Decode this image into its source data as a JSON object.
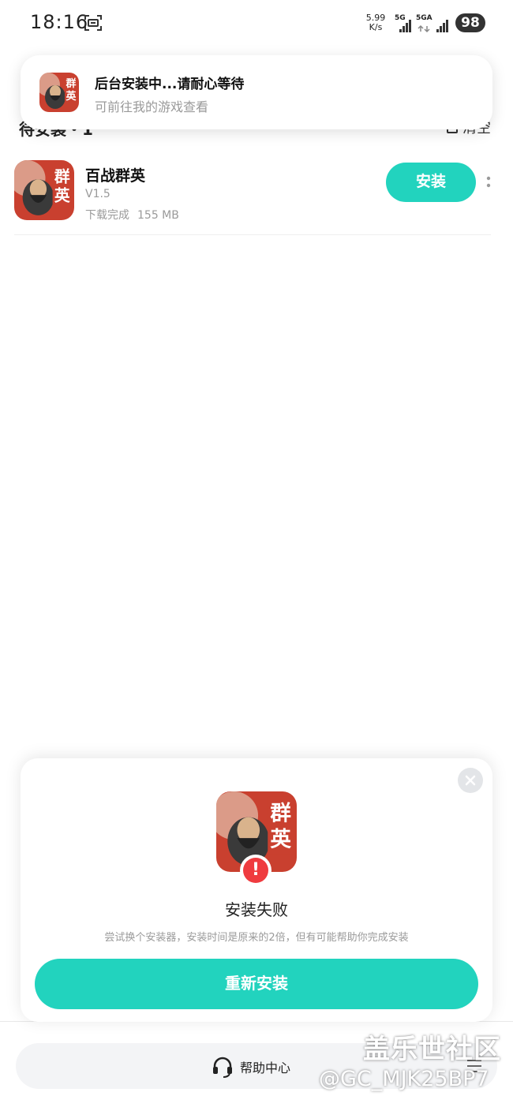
{
  "status_bar": {
    "time": "18:16",
    "net_speed_value": "5.99",
    "net_speed_unit": "K/s",
    "signal_1": "5G",
    "signal_2": "5GA",
    "battery": "98"
  },
  "toast": {
    "title": "后台安装中...请耐心等待",
    "subtitle": "可前往我的游戏查看"
  },
  "list_header": {
    "pending_label": "待安装・1",
    "clear_label": "清空"
  },
  "game": {
    "name": "百战群英",
    "version": "V1.5",
    "status": "下载完成",
    "size": "155 MB",
    "install_label": "安装",
    "icon_text": "群英"
  },
  "modal": {
    "title": "安装失败",
    "description": "尝试换个安装器，安装时间是原来的2倍，但有可能帮助你完成安装",
    "reinstall_label": "重新安装",
    "badge": "!"
  },
  "bottom": {
    "help_label": "帮助中心"
  },
  "watermark": {
    "line1": "盖乐世社区",
    "line2": "@GC_MJK25BP7"
  },
  "colors": {
    "accent": "#22d3be",
    "error": "#ef3b3f",
    "icon_bg": "#c9402f"
  }
}
